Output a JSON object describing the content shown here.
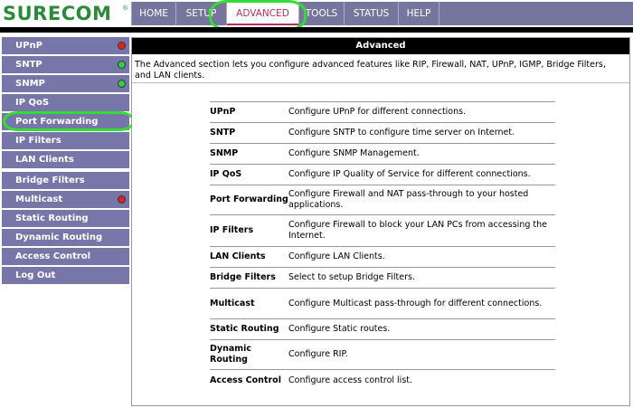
{
  "brand": {
    "logo_text": "SURECOM",
    "reg_mark": "®",
    "logo_color": "#2d8a3a"
  },
  "nav": {
    "tabs": [
      {
        "label": "HOME"
      },
      {
        "label": "SETUP"
      },
      {
        "label": "ADVANCED",
        "active": true
      },
      {
        "label": "TOOLS"
      },
      {
        "label": "STATUS"
      },
      {
        "label": "HELP"
      }
    ],
    "bar_color": "#76759e",
    "active_color": "#b03060"
  },
  "sidebar": {
    "items": [
      {
        "label": "UPnP",
        "status": "red"
      },
      {
        "label": "SNTP",
        "status": "green"
      },
      {
        "label": "SNMP",
        "status": "green"
      },
      {
        "label": "IP QoS"
      },
      {
        "label": "Port Forwarding"
      },
      {
        "label": "IP Filters"
      },
      {
        "label": "LAN Clients"
      },
      {
        "label": "Bridge Filters"
      },
      {
        "label": "Multicast",
        "status": "red"
      },
      {
        "label": "Static Routing"
      },
      {
        "label": "Dynamic Routing"
      },
      {
        "label": "Access Control"
      },
      {
        "label": "Log Out"
      }
    ],
    "item_color": "#7676a8"
  },
  "main": {
    "title": "Advanced",
    "intro": "The Advanced section lets you configure advanced features like RIP, Firewall, NAT, UPnP, IGMP, Bridge Filters, and LAN clients.",
    "features": [
      {
        "name": "UPnP",
        "desc": "Configure UPnP for different connections."
      },
      {
        "name": "SNTP",
        "desc": "Configure SNTP to configure time server on Internet."
      },
      {
        "name": "SNMP",
        "desc": "Configure SNMP Management."
      },
      {
        "name": "IP QoS",
        "desc": "Configure IP Quality of Service for different connections."
      },
      {
        "name": "Port Forwarding",
        "desc": "Configure Firewall and NAT pass-through to your hosted applications."
      },
      {
        "name": "IP Filters",
        "desc": "Configure Firewall to block your LAN PCs from accessing the Internet."
      },
      {
        "name": "LAN Clients",
        "desc": "Configure LAN Clients."
      },
      {
        "name": "Bridge Filters",
        "desc": "Select to setup Bridge Filters."
      },
      {
        "name": "Multicast",
        "desc": "Configure Multicast pass-through for different connections."
      },
      {
        "name": "Static Routing",
        "desc": "Configure Static routes."
      },
      {
        "name": "Dynamic Routing",
        "desc": "Configure RIP."
      },
      {
        "name": "Access Control",
        "desc": "Configure access control list."
      }
    ]
  },
  "highlight_color": "#33dd33"
}
